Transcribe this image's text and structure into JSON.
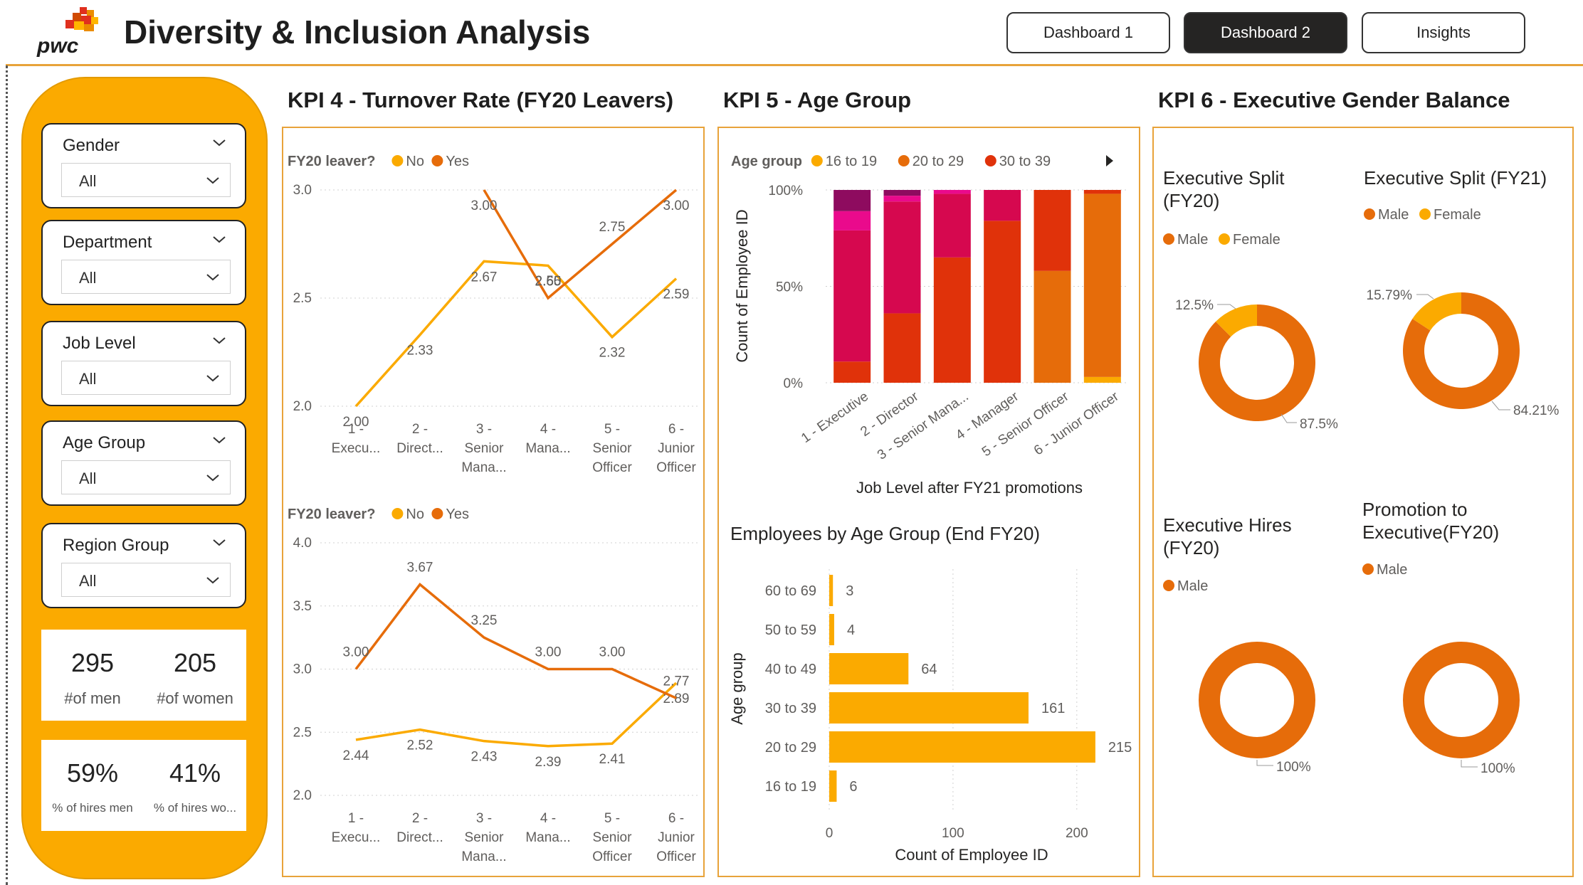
{
  "header": {
    "title": "Diversity & Inclusion Analysis",
    "logo_text": "pwc",
    "nav": [
      {
        "label": "Dashboard 1",
        "active": false
      },
      {
        "label": "Dashboard 2",
        "active": true
      },
      {
        "label": "Insights",
        "active": false
      }
    ]
  },
  "colors": {
    "accent": "#fbaa00",
    "yes": "#e66c0a",
    "no": "#fbaa00",
    "panel_border": "#e8a33a"
  },
  "slicers": [
    {
      "title": "Gender",
      "value": "All"
    },
    {
      "title": "Department",
      "value": "All"
    },
    {
      "title": "Job Level",
      "value": "All"
    },
    {
      "title": "Age Group",
      "value": "All"
    },
    {
      "title": "Region Group",
      "value": "All"
    }
  ],
  "cards": {
    "men_count": "295",
    "men_label": "#of men",
    "women_count": "205",
    "women_label": "#of women",
    "hires_men_pct": "59%",
    "hires_men_label": "% of hires men",
    "hires_women_pct": "41%",
    "hires_women_label": "% of hires wo..."
  },
  "kpi4": {
    "title": "KPI 4 - Turnover Rate (FY20 Leavers)"
  },
  "kpi5": {
    "title": "KPI 5 - Age Group"
  },
  "kpi6": {
    "title": "KPI 6 - Executive Gender Balance"
  },
  "chart_data": [
    {
      "type": "line",
      "legend_title": "FY20 leaver?",
      "categories": [
        "1 - Execu...",
        "2 - Direct...",
        "3 - Senior Mana...",
        "4 - Mana...",
        "5 - Senior Officer",
        "6 - Junior Officer"
      ],
      "ylim": [
        2.0,
        3.0
      ],
      "yticks": [
        "2.0",
        "2.5",
        "3.0"
      ],
      "series": [
        {
          "name": "No",
          "color": "#fbaa00",
          "values": [
            2.0,
            2.33,
            2.67,
            2.65,
            2.32,
            2.59
          ],
          "labels": [
            "2.00",
            "2.33",
            "2.67",
            "2.65",
            "2.32",
            "2.59"
          ]
        },
        {
          "name": "Yes",
          "color": "#e66c0a",
          "values": [
            null,
            null,
            3.0,
            2.5,
            2.75,
            3.0
          ],
          "labels": [
            "",
            "",
            "3.00",
            "2.50",
            "2.75",
            "3.00"
          ]
        }
      ]
    },
    {
      "type": "line",
      "legend_title": "FY20 leaver?",
      "categories": [
        "1 - Execu...",
        "2 - Direct...",
        "3 - Senior Mana...",
        "4 - Mana...",
        "5 - Senior Officer",
        "6 - Junior Officer"
      ],
      "ylim": [
        2.0,
        4.0
      ],
      "yticks": [
        "2.0",
        "2.5",
        "3.0",
        "3.5",
        "4.0"
      ],
      "series": [
        {
          "name": "No",
          "color": "#fbaa00",
          "values": [
            2.44,
            2.52,
            2.43,
            2.39,
            2.41,
            2.89
          ],
          "labels": [
            "2.44",
            "2.52",
            "2.43",
            "2.39",
            "2.41",
            "2.89"
          ]
        },
        {
          "name": "Yes",
          "color": "#e66c0a",
          "values": [
            3.0,
            3.67,
            3.25,
            3.0,
            3.0,
            2.77
          ],
          "labels": [
            "3.00",
            "3.67",
            "3.25",
            "3.00",
            "3.00",
            "2.77"
          ]
        }
      ]
    },
    {
      "type": "bar",
      "stacked": "100%",
      "legend_title": "Age group",
      "legend": [
        {
          "name": "16 to 19",
          "color": "#fbaa00"
        },
        {
          "name": "20 to 29",
          "color": "#e66c0a"
        },
        {
          "name": "30 to 39",
          "color": "#e0320a"
        }
      ],
      "xlabel": "Job Level after FY21 promotions",
      "ylabel": "Count of Employee ID",
      "yticks": [
        "0%",
        "50%",
        "100%"
      ],
      "categories": [
        "1 - Executive",
        "2 - Director",
        "3 - Senior Mana...",
        "4 - Manager",
        "5 - Senior Officer",
        "6 - Junior Officer"
      ],
      "stacks": [
        [
          {
            "v": 0.11,
            "c": "#e0320a"
          },
          {
            "v": 0.68,
            "c": "#d6084f"
          },
          {
            "v": 0.1,
            "c": "#ea0a8c"
          },
          {
            "v": 0.11,
            "c": "#8e0b5f"
          }
        ],
        [
          {
            "v": 0.36,
            "c": "#e0320a"
          },
          {
            "v": 0.58,
            "c": "#d6084f"
          },
          {
            "v": 0.03,
            "c": "#ea0a8c"
          },
          {
            "v": 0.03,
            "c": "#8e0b5f"
          }
        ],
        [
          {
            "v": 0.65,
            "c": "#e0320a"
          },
          {
            "v": 0.33,
            "c": "#d6084f"
          },
          {
            "v": 0.02,
            "c": "#ea0a8c"
          }
        ],
        [
          {
            "v": 0.84,
            "c": "#e0320a"
          },
          {
            "v": 0.16,
            "c": "#d6084f"
          }
        ],
        [
          {
            "v": 0.58,
            "c": "#e66c0a"
          },
          {
            "v": 0.42,
            "c": "#e0320a"
          }
        ],
        [
          {
            "v": 0.03,
            "c": "#fbaa00"
          },
          {
            "v": 0.95,
            "c": "#e66c0a"
          },
          {
            "v": 0.02,
            "c": "#e0320a"
          }
        ]
      ]
    },
    {
      "type": "bar",
      "orientation": "horizontal",
      "title": "Employees by Age Group (End FY20)",
      "xlabel": "Count of Employee ID",
      "ylabel": "Age group",
      "xlim": [
        0,
        230
      ],
      "xticks": [
        0,
        100,
        200
      ],
      "categories": [
        "60 to 69",
        "50 to 59",
        "40 to 49",
        "30 to 39",
        "20 to 29",
        "16 to 19"
      ],
      "values": [
        3,
        4,
        64,
        161,
        215,
        6
      ],
      "color": "#fbaa00"
    },
    {
      "type": "pie",
      "title": "Executive Split (FY20)",
      "legend": [
        "Male",
        "Female"
      ],
      "values": [
        87.5,
        12.5
      ],
      "labels": [
        "87.5%",
        "12.5%"
      ],
      "colors": [
        "#e66c0a",
        "#fbaa00"
      ]
    },
    {
      "type": "pie",
      "title": "Executive Split (FY21)",
      "legend": [
        "Male",
        "Female"
      ],
      "values": [
        84.21,
        15.79
      ],
      "labels": [
        "84.21%",
        "15.79%"
      ],
      "colors": [
        "#e66c0a",
        "#fbaa00"
      ]
    },
    {
      "type": "pie",
      "title": "Executive Hires (FY20)",
      "legend": [
        "Male"
      ],
      "values": [
        100
      ],
      "labels": [
        "100%"
      ],
      "colors": [
        "#e66c0a"
      ]
    },
    {
      "type": "pie",
      "title": "Promotion to Executive(FY20)",
      "legend": [
        "Male"
      ],
      "values": [
        100
      ],
      "labels": [
        "100%"
      ],
      "colors": [
        "#e66c0a"
      ]
    }
  ]
}
